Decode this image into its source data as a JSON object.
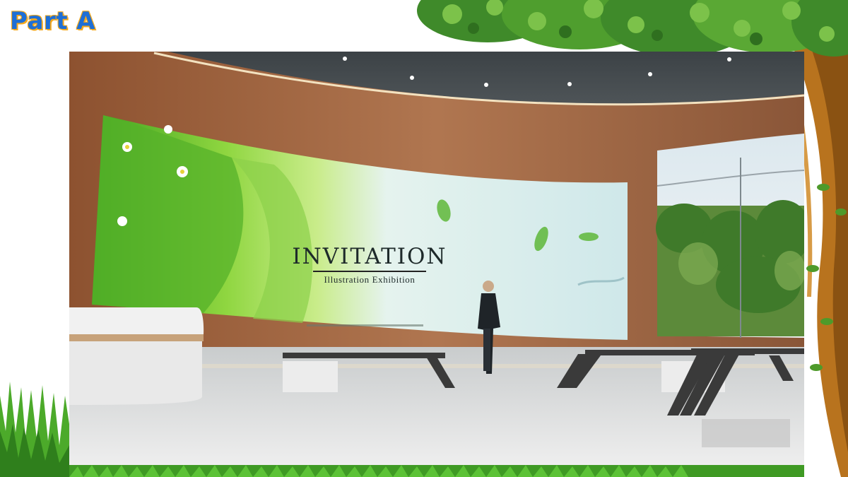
{
  "slide": {
    "label": "Part A"
  },
  "video": {
    "screen_title": "INVITATION",
    "screen_subtitle": "Illustration Exhibition"
  },
  "colors": {
    "label_blue": "#1e6fd6",
    "label_outline": "#f4a81c",
    "tree_trunk": "#b8731e",
    "leaves": "#3f8a2a",
    "grass": "#4caa2a",
    "wood_wall": "#a4653a"
  },
  "icons": [
    "tree-decoration",
    "grass-decoration"
  ]
}
